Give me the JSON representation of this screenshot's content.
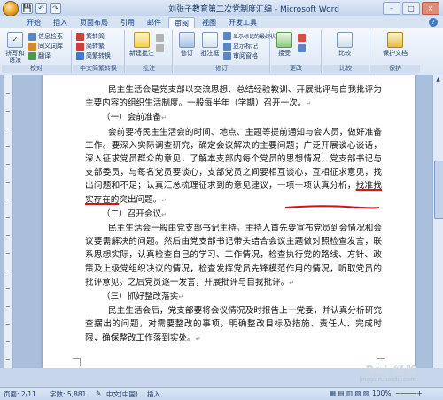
{
  "window": {
    "title": "刘张子教育第二次党制度汇编 - Microsoft Word",
    "controls": [
      "–",
      "□",
      "×"
    ]
  },
  "qat": [
    "💾",
    "↶",
    "↷"
  ],
  "tabs": [
    {
      "label": "开始"
    },
    {
      "label": "插入"
    },
    {
      "label": "页面布局"
    },
    {
      "label": "引用"
    },
    {
      "label": "邮件"
    },
    {
      "label": "审阅"
    },
    {
      "label": "视图"
    },
    {
      "label": "开发工具"
    }
  ],
  "active_tab": "审阅",
  "ribbon": {
    "proofing": {
      "label": "校对",
      "big": "拼写和语法",
      "items": [
        "信息检索",
        "同义词库",
        "翻译"
      ]
    },
    "chinese": {
      "label": "中文简繁转换",
      "items": [
        "繁转简",
        "简转繁",
        "简繁转换"
      ]
    },
    "comments": {
      "label": "批注",
      "big": "新建批注"
    },
    "tracking": {
      "label": "修订",
      "big1": "修订",
      "big2": "批注框",
      "items": [
        "显示标记的最终状态",
        "显示标记",
        "审阅窗格"
      ]
    },
    "changes": {
      "label": "更改",
      "big": "接受"
    },
    "compare": {
      "label": "比较",
      "big": "比较"
    },
    "protect": {
      "label": "保护",
      "big": "保护文档"
    }
  },
  "document": {
    "p1": "民主生活会是党支部以交流思想、总结经验教训、开展批评与自我批评为主要内容的组织生活制度。一般每半年（学期）召开一次。",
    "h1": "（一）会前准备",
    "p2a": "会前要将民主生活会的时间、地点、主题等提前通知与会人员，做好准备工作。要深入实际调查研究，确定会议解决的主要问题；广泛开展谈心谈话，深入征求党员群众的意见，了解本支部内每个党员的思想情况，党支部书记与支部委员，与每名党员要谈心，支部党员之间要相互谈心，互相征求意见，找出问题和不足；认真汇总梳理征求到的意见建议，一项一项认真分析，",
    "p2u": "找准找实存在的",
    "p2b": "突出问题。",
    "h2": "（二）召开会议",
    "p3": "民主生活会一般由党支部书记主持。主持人首先要宣布党员到会情况和会议要需解决的问题。然后由党支部书记带头结合会议主题做对照检查发言，联系思想实际，认真检查自己的学习、工作情况，检查执行党的路线、方针、政策及上级党组织决议的情况，检查发挥党员先锋模范作用的情况，听取党员的批评意见。之后党员逐一发言，开展批评与自我批评。",
    "h3": "（三）抓好整改落实",
    "p4": "民主生活会后，党支部要将会议情况及时报告上一党委，并认真分析研究查摆出的问题，对需要整改的事项，明确整改目标及措施、责任人、完成时限，确保整改工作落到实处。"
  },
  "status": {
    "page": "页面: 2/11",
    "words": "字数: 5,881",
    "lang": "中文(中国)",
    "mode": "插入",
    "zoom": "100%"
  },
  "watermark": {
    "text": "Bai 经验",
    "url": "jingyan.baidu.com"
  }
}
